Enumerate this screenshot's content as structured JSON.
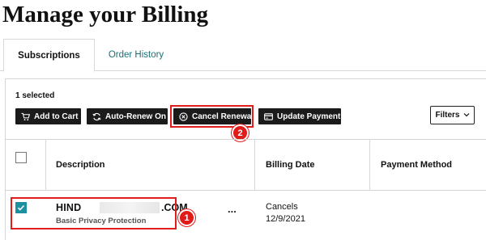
{
  "page_title": "Manage your Billing",
  "tabs": [
    {
      "label": "Subscriptions",
      "active": true
    },
    {
      "label": "Order History",
      "active": false
    }
  ],
  "selection": {
    "count_label": "1 selected"
  },
  "toolbar": {
    "add_to_cart": {
      "label": "Add to Cart",
      "icon": "cart-icon"
    },
    "auto_renew": {
      "label": "Auto-Renew On",
      "icon": "refresh-icon"
    },
    "cancel_renewal": {
      "label": "Cancel Renewal",
      "icon": "cancel-circle-icon"
    },
    "update_payment": {
      "label": "Update Payment",
      "icon": "credit-card-icon"
    },
    "filters": {
      "label": "Filters",
      "icon": "chevron-down-icon"
    }
  },
  "table": {
    "columns": [
      "Description",
      "Billing Date",
      "Payment Method"
    ],
    "rows": [
      {
        "selected": true,
        "domain_visible_start": "HIND",
        "domain_visible_end": ".COM",
        "product": "Basic Privacy Protection",
        "actions_label": "...",
        "billing_status": "Cancels",
        "billing_date": "12/9/2021"
      }
    ]
  },
  "annotations": [
    {
      "number": "1",
      "target": "selected-row"
    },
    {
      "number": "2",
      "target": "cancel-renewal-button"
    }
  ],
  "colors": {
    "highlight": "#e01c1c",
    "checkbox": "#1c8fa0",
    "button_bg": "#1b1b1b",
    "tab_link": "#1a6f73"
  }
}
